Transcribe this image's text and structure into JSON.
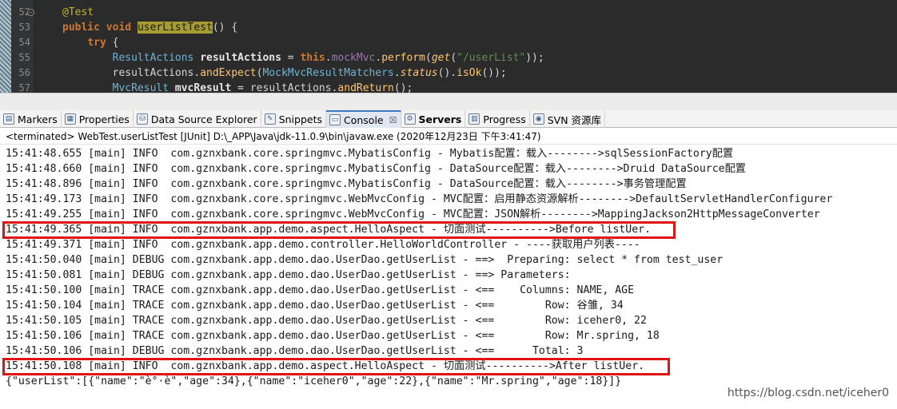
{
  "editor": {
    "lines": [
      {
        "num": "52",
        "parts": [
          {
            "t": "@Test",
            "c": "ann"
          }
        ]
      },
      {
        "num": "53",
        "parts": [
          {
            "t": "public",
            "c": "kw"
          },
          {
            "t": " "
          },
          {
            "t": "void",
            "c": "kw"
          },
          {
            "t": " "
          },
          {
            "t": "userListTest",
            "c": "fn-hl"
          },
          {
            "t": "() {"
          }
        ]
      },
      {
        "num": "54",
        "parts": [
          {
            "t": "    "
          },
          {
            "t": "try",
            "c": "kw"
          },
          {
            "t": " {"
          }
        ]
      },
      {
        "num": "55",
        "parts": [
          {
            "t": "        "
          },
          {
            "t": "ResultActions",
            "c": "type"
          },
          {
            "t": " "
          },
          {
            "t": "resultActions",
            "c": "var"
          },
          {
            "t": " = "
          },
          {
            "t": "this",
            "c": "kw"
          },
          {
            "t": "."
          },
          {
            "t": "mockMvc",
            "c": "field"
          },
          {
            "t": "."
          },
          {
            "t": "perform",
            "c": "method"
          },
          {
            "t": "("
          },
          {
            "t": "get",
            "c": "italic"
          },
          {
            "t": "("
          },
          {
            "t": "\"/userList\"",
            "c": "str"
          },
          {
            "t": "));"
          }
        ]
      },
      {
        "num": "56",
        "parts": [
          {
            "t": "        resultActions."
          },
          {
            "t": "andExpect",
            "c": "method"
          },
          {
            "t": "("
          },
          {
            "t": "MockMvcResultMatchers",
            "c": "type"
          },
          {
            "t": "."
          },
          {
            "t": "status",
            "c": "italic"
          },
          {
            "t": "()."
          },
          {
            "t": "isOk",
            "c": "method"
          },
          {
            "t": "());"
          }
        ]
      },
      {
        "num": "57",
        "parts": [
          {
            "t": "        "
          },
          {
            "t": "MvcResult",
            "c": "type"
          },
          {
            "t": " "
          },
          {
            "t": "mvcResult",
            "c": "var"
          },
          {
            "t": " = resultActions."
          },
          {
            "t": "andReturn",
            "c": "method"
          },
          {
            "t": "();"
          }
        ]
      }
    ]
  },
  "tabs": [
    {
      "name": "tab-markers",
      "label": "Markers",
      "icon": "markers-icon",
      "glyph": "▤",
      "active": false
    },
    {
      "name": "tab-properties",
      "label": "Properties",
      "icon": "properties-icon",
      "glyph": "▦",
      "active": false
    },
    {
      "name": "tab-data-source-explorer",
      "label": "Data Source Explorer",
      "icon": "database-icon",
      "glyph": "⛁",
      "active": false
    },
    {
      "name": "tab-snippets",
      "label": "Snippets",
      "icon": "snippets-icon",
      "glyph": "✎",
      "active": false
    },
    {
      "name": "tab-console",
      "label": "Console",
      "icon": "console-icon",
      "glyph": "▭",
      "active": true,
      "close": "☒"
    },
    {
      "name": "tab-servers",
      "label": "Servers",
      "icon": "servers-icon",
      "glyph": "⚙",
      "active": false,
      "bold": true
    },
    {
      "name": "tab-progress",
      "label": "Progress",
      "icon": "progress-icon",
      "glyph": "▥",
      "active": false
    },
    {
      "name": "tab-svn",
      "label": "SVN 资源库",
      "icon": "svn-icon",
      "glyph": "◉",
      "active": false
    }
  ],
  "console": {
    "header": "<terminated> WebTest.userListTest [JUnit] D:\\_APP\\Java\\jdk-11.0.9\\bin\\javaw.exe (2020年12月23日 下午3:41:47)",
    "lines": [
      "15:41:48.655 [main] INFO  com.gznxbank.core.springmvc.MybatisConfig - Mybatis配置：载入-------->sqlSessionFactory配置",
      "15:41:48.660 [main] INFO  com.gznxbank.core.springmvc.MybatisConfig - DataSource配置：载入-------->Druid DataSource配置",
      "15:41:48.896 [main] INFO  com.gznxbank.core.springmvc.MybatisConfig - DataSource配置：载入-------->事务管理配置",
      "15:41:49.173 [main] INFO  com.gznxbank.core.springmvc.WebMvcConfig - MVC配置：启用静态资源解析-------->DefaultServletHandlerConfigurer",
      "15:41:49.255 [main] INFO  com.gznxbank.core.springmvc.WebMvcConfig - MVC配置：JSON解析-------->MappingJackson2HttpMessageConverter",
      "15:41:49.365 [main] INFO  com.gznxbank.app.demo.aspect.HelloAspect - 切面测试---------->Before listUer.",
      "15:41:49.371 [main] INFO  com.gznxbank.app.demo.controller.HelloWorldController - ----获取用户列表----",
      "15:41:50.040 [main] DEBUG com.gznxbank.app.demo.dao.UserDao.getUserList - ==>  Preparing: select * from test_user",
      "15:41:50.081 [main] DEBUG com.gznxbank.app.demo.dao.UserDao.getUserList - ==> Parameters: ",
      "15:41:50.100 [main] TRACE com.gznxbank.app.demo.dao.UserDao.getUserList - <==    Columns: NAME, AGE",
      "15:41:50.104 [main] TRACE com.gznxbank.app.demo.dao.UserDao.getUserList - <==        Row: 谷雏, 34",
      "15:41:50.105 [main] TRACE com.gznxbank.app.demo.dao.UserDao.getUserList - <==        Row: iceher0, 22",
      "15:41:50.106 [main] TRACE com.gznxbank.app.demo.dao.UserDao.getUserList - <==        Row: Mr.spring, 18",
      "15:41:50.106 [main] DEBUG com.gznxbank.app.demo.dao.UserDao.getUserList - <==      Total: 3",
      "15:41:50.108 [main] INFO  com.gznxbank.app.demo.aspect.HelloAspect - 切面测试---------->After listUer.",
      "{\"userList\":[{\"name\":\"è°·è\",\"age\":34},{\"name\":\"iceher0\",\"age\":22},{\"name\":\"Mr.spring\",\"age\":18}]}"
    ]
  },
  "watermark": "https://blog.csdn.net/iceher0",
  "colors": {
    "highlight_box": "#e01212",
    "editor_bg": "#2b2b2b"
  }
}
